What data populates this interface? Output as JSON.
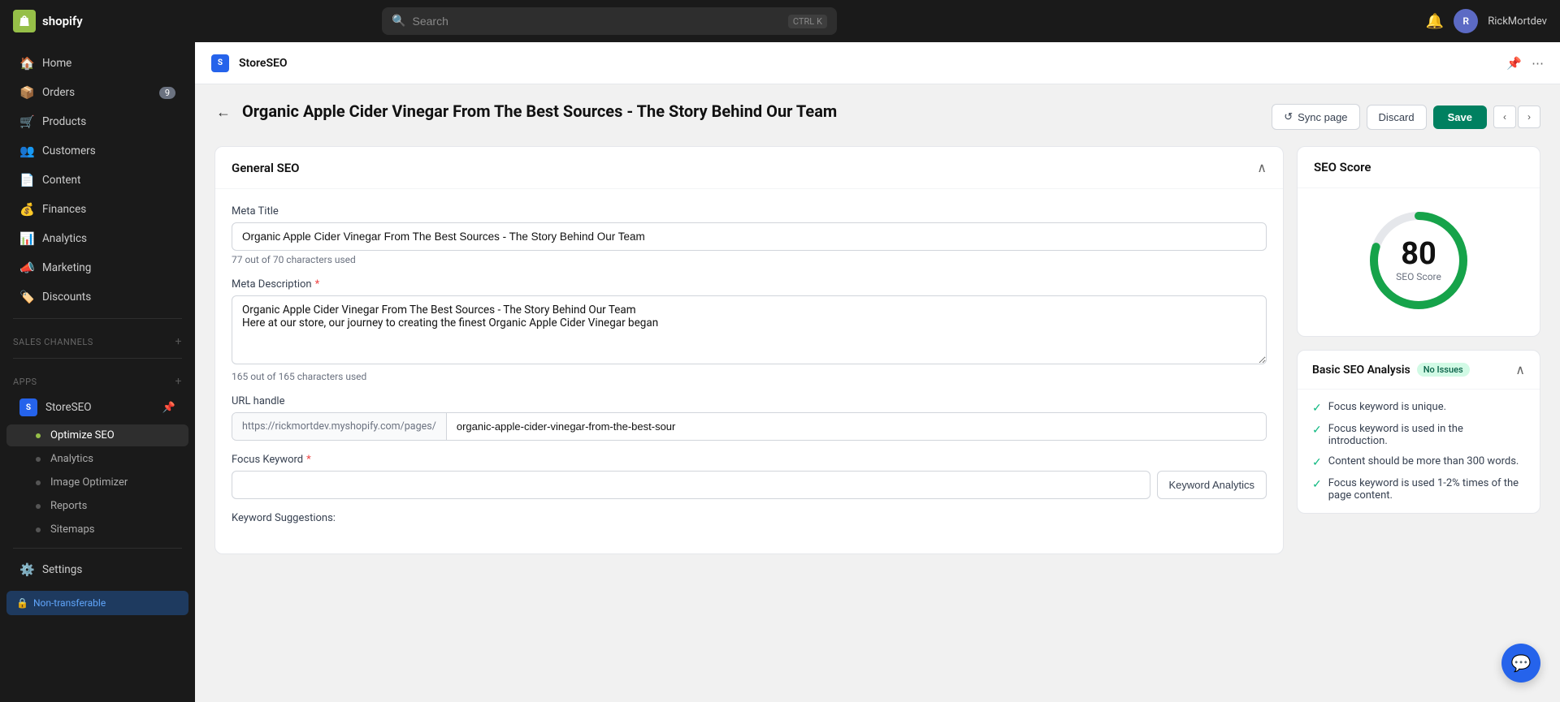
{
  "topbar": {
    "logo_text": "shopify",
    "search_placeholder": "Search",
    "search_shortcut_key1": "CTRL",
    "search_shortcut_key2": "K",
    "username": "RickMortdev"
  },
  "sidebar": {
    "items": [
      {
        "id": "home",
        "label": "Home",
        "icon": "🏠"
      },
      {
        "id": "orders",
        "label": "Orders",
        "icon": "📦",
        "badge": "9"
      },
      {
        "id": "products",
        "label": "Products",
        "icon": "🛒"
      },
      {
        "id": "customers",
        "label": "Customers",
        "icon": "👥"
      },
      {
        "id": "content",
        "label": "Content",
        "icon": "📄"
      },
      {
        "id": "finances",
        "label": "Finances",
        "icon": "💰"
      },
      {
        "id": "analytics",
        "label": "Analytics",
        "icon": "📊"
      },
      {
        "id": "marketing",
        "label": "Marketing",
        "icon": "📣"
      },
      {
        "id": "discounts",
        "label": "Discounts",
        "icon": "🏷️"
      }
    ],
    "sections": {
      "sales_channels": "Sales channels",
      "apps": "Apps"
    },
    "app_item": {
      "label": "StoreSEO",
      "sub_items": [
        {
          "id": "optimize-seo",
          "label": "Optimize SEO",
          "active": true
        },
        {
          "id": "analytics",
          "label": "Analytics"
        },
        {
          "id": "image-optimizer",
          "label": "Image Optimizer"
        },
        {
          "id": "reports",
          "label": "Reports"
        },
        {
          "id": "sitemaps",
          "label": "Sitemaps"
        }
      ]
    },
    "settings_label": "Settings",
    "non_transferable_label": "Non-transferable"
  },
  "app_header": {
    "app_name": "StoreSEO",
    "logo_text": "S"
  },
  "page": {
    "title": "Organic Apple Cider Vinegar From The Best Sources - The Story Behind Our Team",
    "actions": {
      "sync": "Sync page",
      "discard": "Discard",
      "save": "Save"
    },
    "general_seo_title": "General SEO",
    "meta_title_label": "Meta Title",
    "meta_title_value": "Organic Apple Cider Vinegar From The Best Sources - The Story Behind Our Team",
    "meta_title_char_count": "77 out of 70 characters used",
    "meta_description_label": "Meta Description",
    "meta_description_required": true,
    "meta_description_value": "Organic Apple Cider Vinegar From The Best Sources - The Story Behind Our Team\nHere at our store, our journey to creating the finest Organic Apple Cider Vinegar began",
    "meta_description_char_count": "165 out of 165 characters used",
    "url_handle_label": "URL handle",
    "url_prefix": "https://rickmortdev.myshopify.com/pages/",
    "url_handle_value": "organic-apple-cider-vinegar-from-the-best-sour",
    "focus_keyword_label": "Focus Keyword",
    "focus_keyword_required": true,
    "focus_keyword_value": "",
    "keyword_analytics_btn": "Keyword Analytics",
    "keyword_suggestions_label": "Keyword Suggestions:"
  },
  "seo_score": {
    "title": "SEO Score",
    "score": "80",
    "score_label": "SEO Score",
    "circle_progress": 80
  },
  "seo_analysis": {
    "title": "Basic SEO Analysis",
    "badge": "No Issues",
    "checks": [
      "Focus keyword is unique.",
      "Focus keyword is used in the introduction.",
      "Content should be more than 300 words.",
      "Focus keyword is used 1-2% times of the page content."
    ]
  },
  "icons": {
    "back_arrow": "←",
    "collapse": "∧",
    "sync": "↺",
    "prev": "‹",
    "next": "›",
    "check": "✓",
    "bell": "🔔",
    "menu": "☰",
    "chat": "💬",
    "pin": "📌"
  }
}
